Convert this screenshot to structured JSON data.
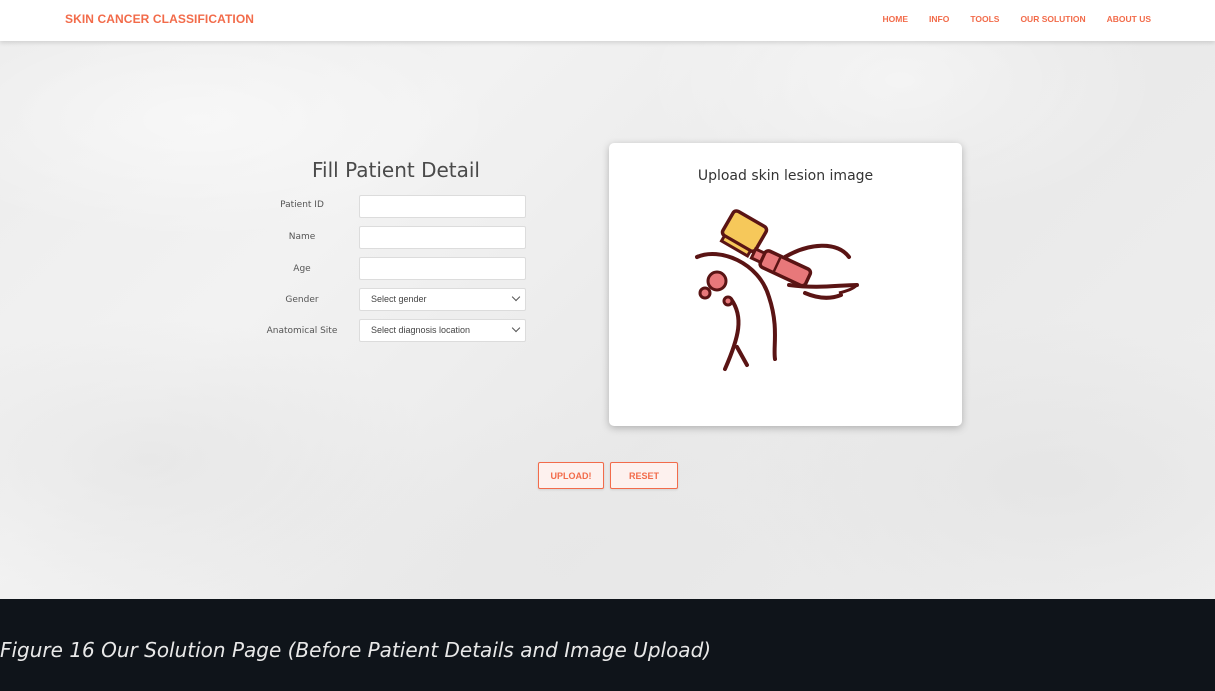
{
  "navbar": {
    "brand": "SKIN CANCER CLASSIFICATION",
    "links": [
      "HOME",
      "INFO",
      "TOOLS",
      "OUR SOLUTION",
      "ABOUT US"
    ]
  },
  "form": {
    "title": "Fill Patient Detail",
    "fields": {
      "patient_id": {
        "label": "Patient ID",
        "value": ""
      },
      "name": {
        "label": "Name",
        "value": ""
      },
      "age": {
        "label": "Age",
        "value": ""
      },
      "gender": {
        "label": "Gender",
        "selected": "Select gender"
      },
      "anatomical_site": {
        "label": "Anatomical Site",
        "selected": "Select diagnosis location"
      }
    }
  },
  "upload": {
    "title": "Upload skin lesion image",
    "illustration_icon": "dermatoscope-skin-icon"
  },
  "buttons": {
    "upload": "UPLOAD!",
    "reset": "RESET"
  },
  "caption": "Figure 16 Our Solution Page (Before Patient Details and Image Upload)",
  "colors": {
    "accent": "#f26b4a",
    "footer_bg": "#0f141a"
  }
}
